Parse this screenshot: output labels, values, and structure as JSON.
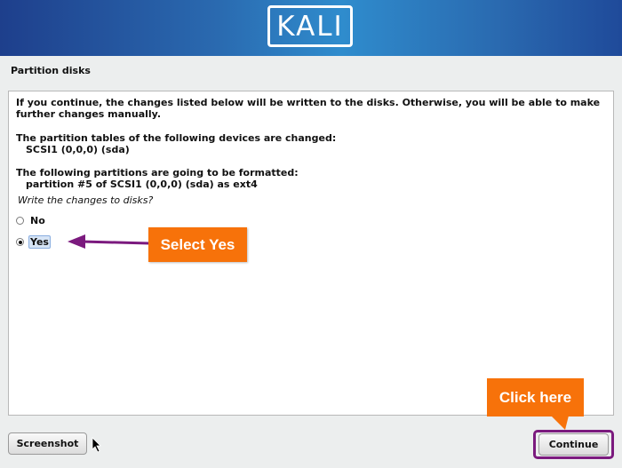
{
  "banner": {
    "logo_text": "KALI"
  },
  "page": {
    "title": "Partition disks"
  },
  "content": {
    "intro_line1": "If you continue, the changes listed below will be written to the disks. Otherwise, you will be able to make",
    "intro_line2": "further changes manually.",
    "tables_heading": "The partition tables of the following devices are changed:",
    "tables_item": "SCSI1 (0,0,0) (sda)",
    "format_heading": "The following partitions are going to be formatted:",
    "format_item": "partition #5 of SCSI1 (0,0,0) (sda) as ext4",
    "question": "Write the changes to disks?",
    "options": [
      {
        "label": "No",
        "selected": false
      },
      {
        "label": "Yes",
        "selected": true
      }
    ]
  },
  "annotations": {
    "select_yes": "Select Yes",
    "click_here": "Click here",
    "arrow_color": "#7b1a7e",
    "callout_color": "#f7720a"
  },
  "buttons": {
    "screenshot": "Screenshot",
    "continue": "Continue"
  },
  "icons": [
    "mouse-pointer-icon",
    "arrow-left-icon"
  ]
}
